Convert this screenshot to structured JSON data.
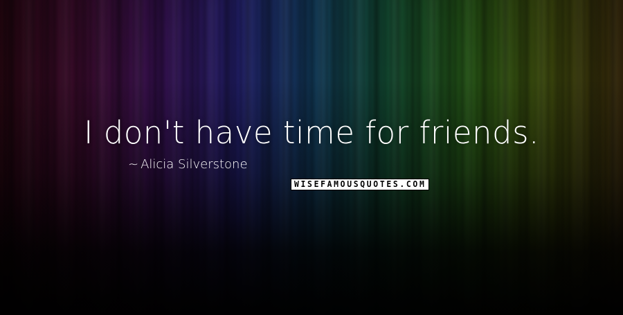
{
  "quote": {
    "text": "I don't have time for friends.",
    "author_prefix": "~",
    "author": "Alicia Silverstone"
  },
  "watermark": {
    "text": "WISEFAMOUSQUOTES.COM"
  },
  "colors": {
    "text": "#ffffff",
    "background": "#05040a",
    "watermark_bg": "#ffffff",
    "watermark_text": "#000000"
  }
}
